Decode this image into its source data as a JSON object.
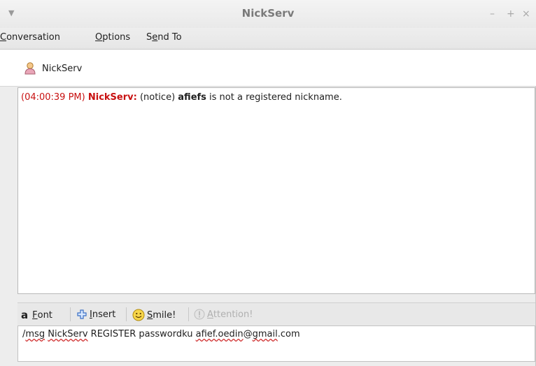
{
  "window": {
    "title": "NickServ",
    "controls": {
      "minimize": "–",
      "maximize": "+",
      "close": "×"
    }
  },
  "menubar": {
    "items": [
      {
        "label": "Conversation",
        "mnemonic": "C",
        "rest": "onversation"
      },
      {
        "label": "Options",
        "mnemonic": "O",
        "rest": "ptions"
      },
      {
        "label": "Send To",
        "pre": "S",
        "mnemonic": "e",
        "rest": "nd To"
      }
    ]
  },
  "buddy": {
    "name": "NickServ",
    "icon": "user-avatar-icon"
  },
  "chat": {
    "messages": [
      {
        "timestamp": "(04:00:39 PM)",
        "sender": "NickServ:",
        "prefix": " (notice) ",
        "bold": "afiefs",
        "text": " is not a registered nickname."
      }
    ]
  },
  "toolbar": {
    "font": {
      "icon": "a",
      "mnemonic": "F",
      "rest": "ont"
    },
    "insert": {
      "mnemonic": "I",
      "rest": "nsert"
    },
    "smile": {
      "mnemonic": "S",
      "rest": "mile!"
    },
    "attention": {
      "mnemonic": "A",
      "rest": "ttention!"
    }
  },
  "entry": {
    "words": [
      {
        "t": "/",
        "spell": false
      },
      {
        "t": "msg",
        "spell": true
      },
      {
        "t": " ",
        "spell": false
      },
      {
        "t": "NickServ",
        "spell": true
      },
      {
        "t": " REGISTER passwordku ",
        "spell": false
      },
      {
        "t": "afief.oedin",
        "spell": true
      },
      {
        "t": "@",
        "spell": false
      },
      {
        "t": "gmail",
        "spell": true
      },
      {
        "t": ".com",
        "spell": false
      }
    ]
  },
  "colors": {
    "timestamp": "#c81010",
    "sender": "#c81010",
    "spellcheck": "#d03030"
  }
}
